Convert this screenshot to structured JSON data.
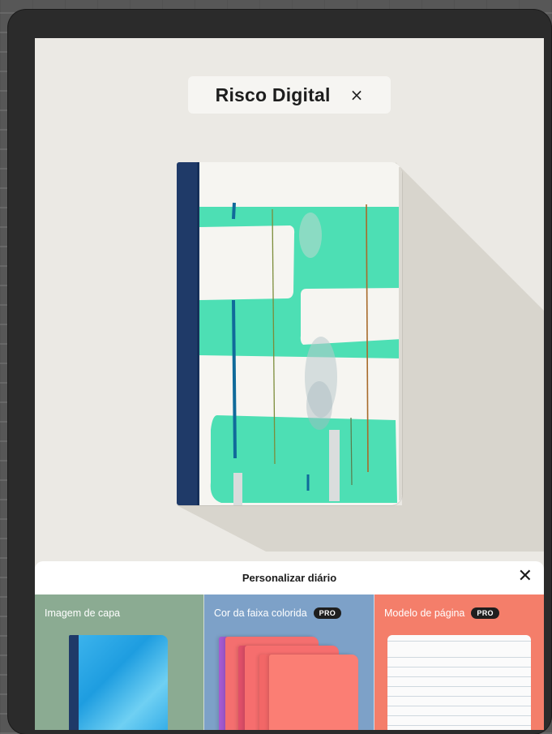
{
  "journal": {
    "title": "Risco Digital",
    "close_icon": "×"
  },
  "sheet": {
    "title": "Personalizar diário",
    "close_icon": "✕",
    "panels": [
      {
        "label": "Imagem de capa",
        "pro": false
      },
      {
        "label": "Cor da faixa colorida",
        "pro": true,
        "badge": "PRO"
      },
      {
        "label": "Modelo de página",
        "pro": true,
        "badge": "PRO"
      }
    ]
  },
  "colors": {
    "spine": "#1f3a68",
    "stripe": "#4ddfb4",
    "cover_panel": "#8bab92",
    "color_panel": "#7da1c8",
    "template_panel": "#f47e6a"
  }
}
